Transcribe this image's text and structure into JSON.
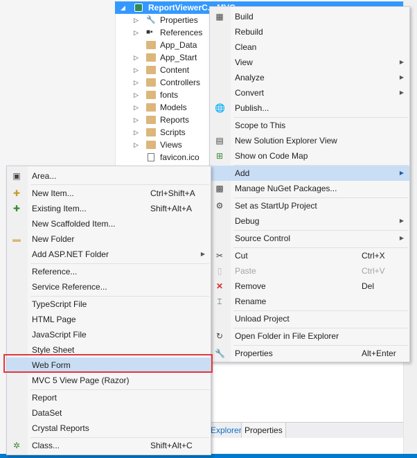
{
  "solution_explorer": {
    "project_label": "ReportViewerC... MVC",
    "items": [
      {
        "label": "Properties",
        "icon": "wrench-icon",
        "expandable": true
      },
      {
        "label": "References",
        "icon": "references-icon",
        "expandable": true
      },
      {
        "label": "App_Data",
        "icon": "folder-icon",
        "expandable": false
      },
      {
        "label": "App_Start",
        "icon": "folder-icon",
        "expandable": true
      },
      {
        "label": "Content",
        "icon": "folder-icon",
        "expandable": true
      },
      {
        "label": "Controllers",
        "icon": "folder-icon",
        "expandable": true
      },
      {
        "label": "fonts",
        "icon": "folder-icon",
        "expandable": true
      },
      {
        "label": "Models",
        "icon": "folder-icon",
        "expandable": true
      },
      {
        "label": "Reports",
        "icon": "folder-icon",
        "expandable": true
      },
      {
        "label": "Scripts",
        "icon": "folder-icon",
        "expandable": true
      },
      {
        "label": "Views",
        "icon": "folder-icon",
        "expandable": true
      },
      {
        "label": "favicon.ico",
        "icon": "file-icon",
        "expandable": false
      }
    ],
    "tabs": {
      "explorer": "Explorer",
      "properties": "Properties"
    }
  },
  "context_menu": {
    "items": [
      {
        "label": "Build"
      },
      {
        "label": "Rebuild"
      },
      {
        "label": "Clean"
      },
      {
        "label": "View",
        "sub": true
      },
      {
        "label": "Analyze",
        "sub": true
      },
      {
        "label": "Convert",
        "sub": true
      },
      {
        "label": "Publish..."
      },
      {
        "label": "Scope to This"
      },
      {
        "label": "New Solution Explorer View"
      },
      {
        "label": "Show on Code Map"
      },
      {
        "label": "Add",
        "sub": true
      },
      {
        "label": "Manage NuGet Packages..."
      },
      {
        "label": "Set as StartUp Project"
      },
      {
        "label": "Debug",
        "sub": true
      },
      {
        "label": "Source Control",
        "sub": true
      },
      {
        "label": "Cut",
        "shortcut": "Ctrl+X"
      },
      {
        "label": "Paste",
        "shortcut": "Ctrl+V"
      },
      {
        "label": "Remove",
        "shortcut": "Del"
      },
      {
        "label": "Rename"
      },
      {
        "label": "Unload Project"
      },
      {
        "label": "Open Folder in File Explorer"
      },
      {
        "label": "Properties",
        "shortcut": "Alt+Enter"
      }
    ]
  },
  "add_submenu": {
    "items": [
      {
        "label": "Area..."
      },
      {
        "label": "New Item...",
        "shortcut": "Ctrl+Shift+A"
      },
      {
        "label": "Existing Item...",
        "shortcut": "Shift+Alt+A"
      },
      {
        "label": "New Scaffolded Item..."
      },
      {
        "label": "New Folder"
      },
      {
        "label": "Add ASP.NET Folder",
        "sub": true
      },
      {
        "label": "Reference..."
      },
      {
        "label": "Service Reference..."
      },
      {
        "label": "TypeScript File"
      },
      {
        "label": "HTML Page"
      },
      {
        "label": "JavaScript File"
      },
      {
        "label": "Style Sheet"
      },
      {
        "label": "Web Form"
      },
      {
        "label": "MVC 5 View Page (Razor)"
      },
      {
        "label": "Report"
      },
      {
        "label": "DataSet"
      },
      {
        "label": "Crystal Reports"
      },
      {
        "label": "Class...",
        "shortcut": "Shift+Alt+C"
      }
    ]
  },
  "colors": {
    "highlight": "#c9def5",
    "selection": "#3399ff",
    "annotation": "#e0383e"
  }
}
